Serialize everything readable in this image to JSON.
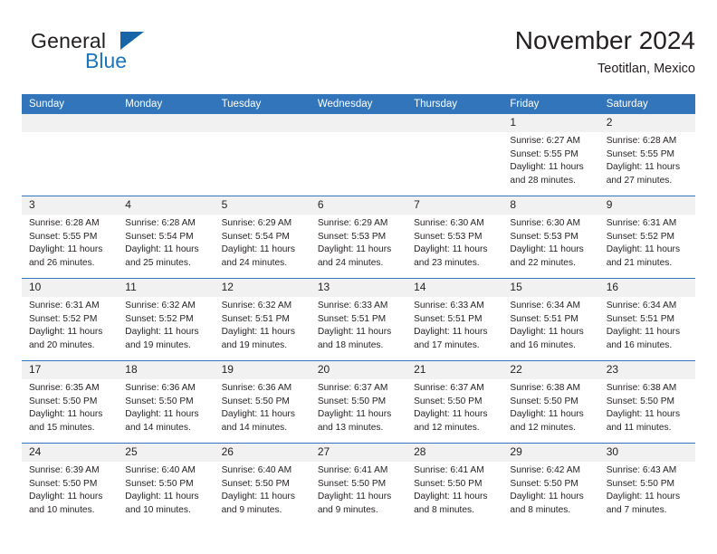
{
  "brand": {
    "general": "General",
    "blue": "Blue",
    "triangle_color": "#1565a8",
    "blue_color": "#1b75bb"
  },
  "header": {
    "title": "November 2024",
    "subtitle": "Teotitlan, Mexico"
  },
  "colors": {
    "header_row_bg": "#3275bb",
    "header_row_text": "#ffffff",
    "daynum_bg": "#f1f1f1",
    "cell_border": "#3275bb",
    "text": "#231f20"
  },
  "weekday_headers": [
    "Sunday",
    "Monday",
    "Tuesday",
    "Wednesday",
    "Thursday",
    "Friday",
    "Saturday"
  ],
  "weeks": [
    [
      {
        "day": "",
        "empty": true,
        "sunrise": "",
        "sunset": "",
        "daylight_line1": "",
        "daylight_line2": ""
      },
      {
        "day": "",
        "empty": true,
        "sunrise": "",
        "sunset": "",
        "daylight_line1": "",
        "daylight_line2": ""
      },
      {
        "day": "",
        "empty": true,
        "sunrise": "",
        "sunset": "",
        "daylight_line1": "",
        "daylight_line2": ""
      },
      {
        "day": "",
        "empty": true,
        "sunrise": "",
        "sunset": "",
        "daylight_line1": "",
        "daylight_line2": ""
      },
      {
        "day": "",
        "empty": true,
        "sunrise": "",
        "sunset": "",
        "daylight_line1": "",
        "daylight_line2": ""
      },
      {
        "day": "1",
        "empty": false,
        "sunrise": "Sunrise: 6:27 AM",
        "sunset": "Sunset: 5:55 PM",
        "daylight_line1": "Daylight: 11 hours",
        "daylight_line2": "and 28 minutes."
      },
      {
        "day": "2",
        "empty": false,
        "sunrise": "Sunrise: 6:28 AM",
        "sunset": "Sunset: 5:55 PM",
        "daylight_line1": "Daylight: 11 hours",
        "daylight_line2": "and 27 minutes."
      }
    ],
    [
      {
        "day": "3",
        "empty": false,
        "sunrise": "Sunrise: 6:28 AM",
        "sunset": "Sunset: 5:55 PM",
        "daylight_line1": "Daylight: 11 hours",
        "daylight_line2": "and 26 minutes."
      },
      {
        "day": "4",
        "empty": false,
        "sunrise": "Sunrise: 6:28 AM",
        "sunset": "Sunset: 5:54 PM",
        "daylight_line1": "Daylight: 11 hours",
        "daylight_line2": "and 25 minutes."
      },
      {
        "day": "5",
        "empty": false,
        "sunrise": "Sunrise: 6:29 AM",
        "sunset": "Sunset: 5:54 PM",
        "daylight_line1": "Daylight: 11 hours",
        "daylight_line2": "and 24 minutes."
      },
      {
        "day": "6",
        "empty": false,
        "sunrise": "Sunrise: 6:29 AM",
        "sunset": "Sunset: 5:53 PM",
        "daylight_line1": "Daylight: 11 hours",
        "daylight_line2": "and 24 minutes."
      },
      {
        "day": "7",
        "empty": false,
        "sunrise": "Sunrise: 6:30 AM",
        "sunset": "Sunset: 5:53 PM",
        "daylight_line1": "Daylight: 11 hours",
        "daylight_line2": "and 23 minutes."
      },
      {
        "day": "8",
        "empty": false,
        "sunrise": "Sunrise: 6:30 AM",
        "sunset": "Sunset: 5:53 PM",
        "daylight_line1": "Daylight: 11 hours",
        "daylight_line2": "and 22 minutes."
      },
      {
        "day": "9",
        "empty": false,
        "sunrise": "Sunrise: 6:31 AM",
        "sunset": "Sunset: 5:52 PM",
        "daylight_line1": "Daylight: 11 hours",
        "daylight_line2": "and 21 minutes."
      }
    ],
    [
      {
        "day": "10",
        "empty": false,
        "sunrise": "Sunrise: 6:31 AM",
        "sunset": "Sunset: 5:52 PM",
        "daylight_line1": "Daylight: 11 hours",
        "daylight_line2": "and 20 minutes."
      },
      {
        "day": "11",
        "empty": false,
        "sunrise": "Sunrise: 6:32 AM",
        "sunset": "Sunset: 5:52 PM",
        "daylight_line1": "Daylight: 11 hours",
        "daylight_line2": "and 19 minutes."
      },
      {
        "day": "12",
        "empty": false,
        "sunrise": "Sunrise: 6:32 AM",
        "sunset": "Sunset: 5:51 PM",
        "daylight_line1": "Daylight: 11 hours",
        "daylight_line2": "and 19 minutes."
      },
      {
        "day": "13",
        "empty": false,
        "sunrise": "Sunrise: 6:33 AM",
        "sunset": "Sunset: 5:51 PM",
        "daylight_line1": "Daylight: 11 hours",
        "daylight_line2": "and 18 minutes."
      },
      {
        "day": "14",
        "empty": false,
        "sunrise": "Sunrise: 6:33 AM",
        "sunset": "Sunset: 5:51 PM",
        "daylight_line1": "Daylight: 11 hours",
        "daylight_line2": "and 17 minutes."
      },
      {
        "day": "15",
        "empty": false,
        "sunrise": "Sunrise: 6:34 AM",
        "sunset": "Sunset: 5:51 PM",
        "daylight_line1": "Daylight: 11 hours",
        "daylight_line2": "and 16 minutes."
      },
      {
        "day": "16",
        "empty": false,
        "sunrise": "Sunrise: 6:34 AM",
        "sunset": "Sunset: 5:51 PM",
        "daylight_line1": "Daylight: 11 hours",
        "daylight_line2": "and 16 minutes."
      }
    ],
    [
      {
        "day": "17",
        "empty": false,
        "sunrise": "Sunrise: 6:35 AM",
        "sunset": "Sunset: 5:50 PM",
        "daylight_line1": "Daylight: 11 hours",
        "daylight_line2": "and 15 minutes."
      },
      {
        "day": "18",
        "empty": false,
        "sunrise": "Sunrise: 6:36 AM",
        "sunset": "Sunset: 5:50 PM",
        "daylight_line1": "Daylight: 11 hours",
        "daylight_line2": "and 14 minutes."
      },
      {
        "day": "19",
        "empty": false,
        "sunrise": "Sunrise: 6:36 AM",
        "sunset": "Sunset: 5:50 PM",
        "daylight_line1": "Daylight: 11 hours",
        "daylight_line2": "and 14 minutes."
      },
      {
        "day": "20",
        "empty": false,
        "sunrise": "Sunrise: 6:37 AM",
        "sunset": "Sunset: 5:50 PM",
        "daylight_line1": "Daylight: 11 hours",
        "daylight_line2": "and 13 minutes."
      },
      {
        "day": "21",
        "empty": false,
        "sunrise": "Sunrise: 6:37 AM",
        "sunset": "Sunset: 5:50 PM",
        "daylight_line1": "Daylight: 11 hours",
        "daylight_line2": "and 12 minutes."
      },
      {
        "day": "22",
        "empty": false,
        "sunrise": "Sunrise: 6:38 AM",
        "sunset": "Sunset: 5:50 PM",
        "daylight_line1": "Daylight: 11 hours",
        "daylight_line2": "and 12 minutes."
      },
      {
        "day": "23",
        "empty": false,
        "sunrise": "Sunrise: 6:38 AM",
        "sunset": "Sunset: 5:50 PM",
        "daylight_line1": "Daylight: 11 hours",
        "daylight_line2": "and 11 minutes."
      }
    ],
    [
      {
        "day": "24",
        "empty": false,
        "sunrise": "Sunrise: 6:39 AM",
        "sunset": "Sunset: 5:50 PM",
        "daylight_line1": "Daylight: 11 hours",
        "daylight_line2": "and 10 minutes."
      },
      {
        "day": "25",
        "empty": false,
        "sunrise": "Sunrise: 6:40 AM",
        "sunset": "Sunset: 5:50 PM",
        "daylight_line1": "Daylight: 11 hours",
        "daylight_line2": "and 10 minutes."
      },
      {
        "day": "26",
        "empty": false,
        "sunrise": "Sunrise: 6:40 AM",
        "sunset": "Sunset: 5:50 PM",
        "daylight_line1": "Daylight: 11 hours",
        "daylight_line2": "and 9 minutes."
      },
      {
        "day": "27",
        "empty": false,
        "sunrise": "Sunrise: 6:41 AM",
        "sunset": "Sunset: 5:50 PM",
        "daylight_line1": "Daylight: 11 hours",
        "daylight_line2": "and 9 minutes."
      },
      {
        "day": "28",
        "empty": false,
        "sunrise": "Sunrise: 6:41 AM",
        "sunset": "Sunset: 5:50 PM",
        "daylight_line1": "Daylight: 11 hours",
        "daylight_line2": "and 8 minutes."
      },
      {
        "day": "29",
        "empty": false,
        "sunrise": "Sunrise: 6:42 AM",
        "sunset": "Sunset: 5:50 PM",
        "daylight_line1": "Daylight: 11 hours",
        "daylight_line2": "and 8 minutes."
      },
      {
        "day": "30",
        "empty": false,
        "sunrise": "Sunrise: 6:43 AM",
        "sunset": "Sunset: 5:50 PM",
        "daylight_line1": "Daylight: 11 hours",
        "daylight_line2": "and 7 minutes."
      }
    ]
  ]
}
